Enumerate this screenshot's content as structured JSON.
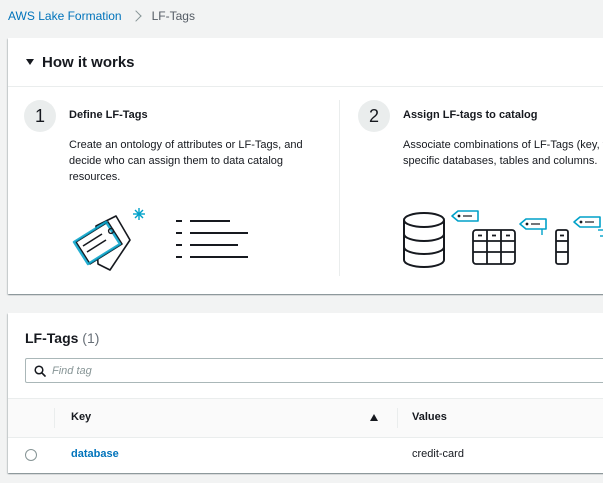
{
  "breadcrumb": {
    "parent": "AWS Lake Formation",
    "current": "LF-Tags"
  },
  "how_it_works": {
    "title": "How it works",
    "steps": [
      {
        "number": "1",
        "title": "Define LF-Tags",
        "description": "Create an ontology of attributes or LF-Tags, and decide who can assign them to data catalog resources.",
        "illustration": "tag-list-illustration"
      },
      {
        "number": "2",
        "title": "Assign LF-tags to catalog",
        "description": "Associate combinations of LF-Tags (key, value) to specific databases, tables and columns.",
        "illustration": "database-table-column-illustration"
      }
    ]
  },
  "lf_tags": {
    "title": "LF-Tags",
    "count": "(1)",
    "search": {
      "placeholder": "Find tag",
      "value": ""
    },
    "columns": {
      "key": "Key",
      "values": "Values"
    },
    "sort": {
      "column": "Key",
      "direction": "ascending"
    },
    "rows": [
      {
        "key": "database",
        "values": "credit-card",
        "selected": false
      }
    ]
  },
  "colors": {
    "link": "#0073bb",
    "accent_teal": "#00a1c9",
    "text": "#16191f",
    "border": "#eaeded",
    "background": "#f2f3f3"
  },
  "icons": {
    "collapse": "caret-down-icon",
    "search": "search-icon",
    "sort": "sort-ascending-icon",
    "breadcrumb_separator": "chevron-right-icon"
  }
}
